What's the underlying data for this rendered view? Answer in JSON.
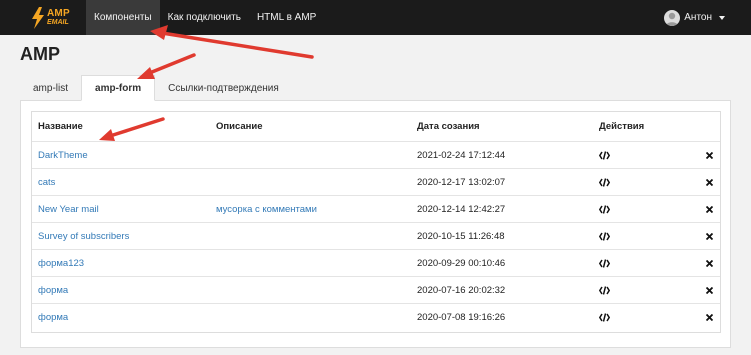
{
  "brand": {
    "amp": "AMP",
    "email": "EMAIL"
  },
  "nav": {
    "items": [
      {
        "label": "Компоненты",
        "active": true
      },
      {
        "label": "Как подключить",
        "active": false
      },
      {
        "label": "HTML в AMP",
        "active": false
      }
    ],
    "user_name": "Антон"
  },
  "page_title": "AMP",
  "tabs": [
    {
      "label": "amp-list",
      "active": false
    },
    {
      "label": "amp-form",
      "active": true
    },
    {
      "label": "Ссылки-подтверждения",
      "active": false
    }
  ],
  "table": {
    "headers": {
      "name": "Название",
      "desc": "Описание",
      "date": "Дата созания",
      "actions": "Действия"
    },
    "rows": [
      {
        "name": "DarkTheme",
        "desc": "",
        "date": "2021-02-24 17:12:44"
      },
      {
        "name": "cats",
        "desc": "",
        "date": "2020-12-17 13:02:07"
      },
      {
        "name": "New Year mail",
        "desc": "мусорка с комментами",
        "date": "2020-12-14 12:42:27"
      },
      {
        "name": "Survey of subscribers",
        "desc": "",
        "date": "2020-10-15 11:26:48"
      },
      {
        "name": "форма123",
        "desc": "",
        "date": "2020-09-29 00:10:46"
      },
      {
        "name": "форма",
        "desc": "",
        "date": "2020-07-16 20:02:32"
      },
      {
        "name": "форма",
        "desc": "",
        "date": "2020-07-08 19:16:26"
      }
    ]
  },
  "colors": {
    "navbar": "#1b1b1b",
    "brand": "#f5a623",
    "link": "#337ab7",
    "annotation_arrow": "#e03a2f"
  },
  "icons": {
    "code": "code-icon",
    "delete": "close-icon",
    "bolt": "lightning-icon"
  }
}
